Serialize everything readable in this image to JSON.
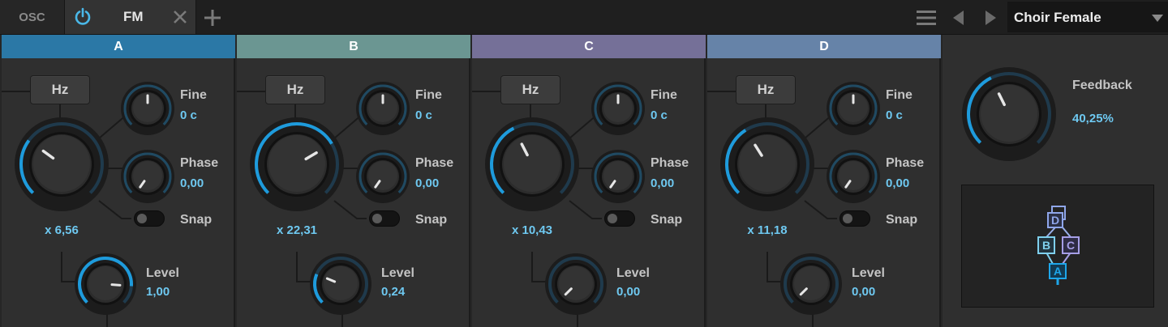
{
  "tabs": {
    "osc_label": "OSC",
    "fm_label": "FM"
  },
  "preset": {
    "name": "Choir Female"
  },
  "colors": {
    "A": "#2b78a6",
    "B": "#6b9692",
    "C": "#757098",
    "D": "#6683a8",
    "accent": "#1e9bdc",
    "value": "#6ec8f0"
  },
  "operators": [
    {
      "name": "A",
      "ratio_label": "Hz",
      "ratio": "x 6,56",
      "ratio_level": 0.3,
      "fine_label": "Fine",
      "fine": "0 c",
      "phase_label": "Phase",
      "phase": "0,00",
      "snap_label": "Snap",
      "level_label": "Level",
      "level": "1,00",
      "level_level": 0.85,
      "color": "#2b78a6"
    },
    {
      "name": "B",
      "ratio_label": "Hz",
      "ratio": "x 22,31",
      "ratio_level": 0.72,
      "fine_label": "Fine",
      "fine": "0 c",
      "phase_label": "Phase",
      "phase": "0,00",
      "snap_label": "Snap",
      "level_label": "Level",
      "level": "0,24",
      "level_level": 0.25,
      "color": "#6b9692"
    },
    {
      "name": "C",
      "ratio_label": "Hz",
      "ratio": "x 10,43",
      "ratio_level": 0.4,
      "fine_label": "Fine",
      "fine": "0 c",
      "phase_label": "Phase",
      "phase": "0,00",
      "snap_label": "Snap",
      "level_label": "Level",
      "level": "0,00",
      "level_level": 0.0,
      "color": "#757098"
    },
    {
      "name": "D",
      "ratio_label": "Hz",
      "ratio": "x 11,18",
      "ratio_level": 0.38,
      "fine_label": "Fine",
      "fine": "0 c",
      "phase_label": "Phase",
      "phase": "0,00",
      "snap_label": "Snap",
      "level_label": "Level",
      "level": "0,00",
      "level_level": 0.0,
      "color": "#6683a8"
    }
  ],
  "feedback": {
    "label": "Feedback",
    "value": "40,25%",
    "level": 0.4025
  },
  "algorithm": {
    "nodes": [
      "D",
      "B",
      "C",
      "A"
    ]
  },
  "icons": {
    "power": "power-icon",
    "close": "close-icon",
    "add": "plus-icon",
    "menu": "menu-icon",
    "prev": "prev-arrow-icon",
    "next": "next-arrow-icon",
    "dropdown": "chevron-down-icon"
  }
}
